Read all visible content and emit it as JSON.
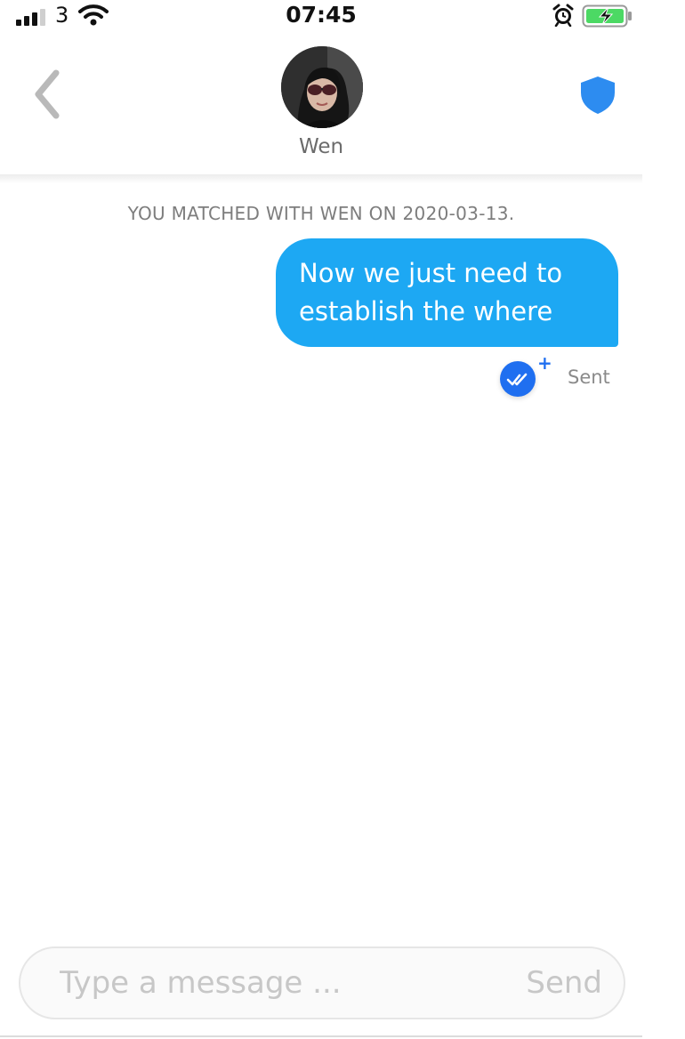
{
  "status_bar": {
    "carrier": "3",
    "time": "07:45",
    "signal_bars": 3,
    "battery_charging": true,
    "battery_color": "#4cd964"
  },
  "header": {
    "contact_name": "Wen",
    "back_icon": "chevron-left-icon",
    "safety_icon": "shield-icon",
    "shield_color": "#2d8cf0"
  },
  "conversation": {
    "match_notice": "YOU MATCHED WITH WEN ON 2020-03-13.",
    "messages": [
      {
        "lines": [
          "Now we just need to",
          "establish the where"
        ],
        "bubble_color": "#1da8f3",
        "status": "Sent",
        "status_icon": "double-check-icon"
      }
    ]
  },
  "composer": {
    "placeholder": "Type a message ...",
    "value": "",
    "send_label": "Send"
  }
}
